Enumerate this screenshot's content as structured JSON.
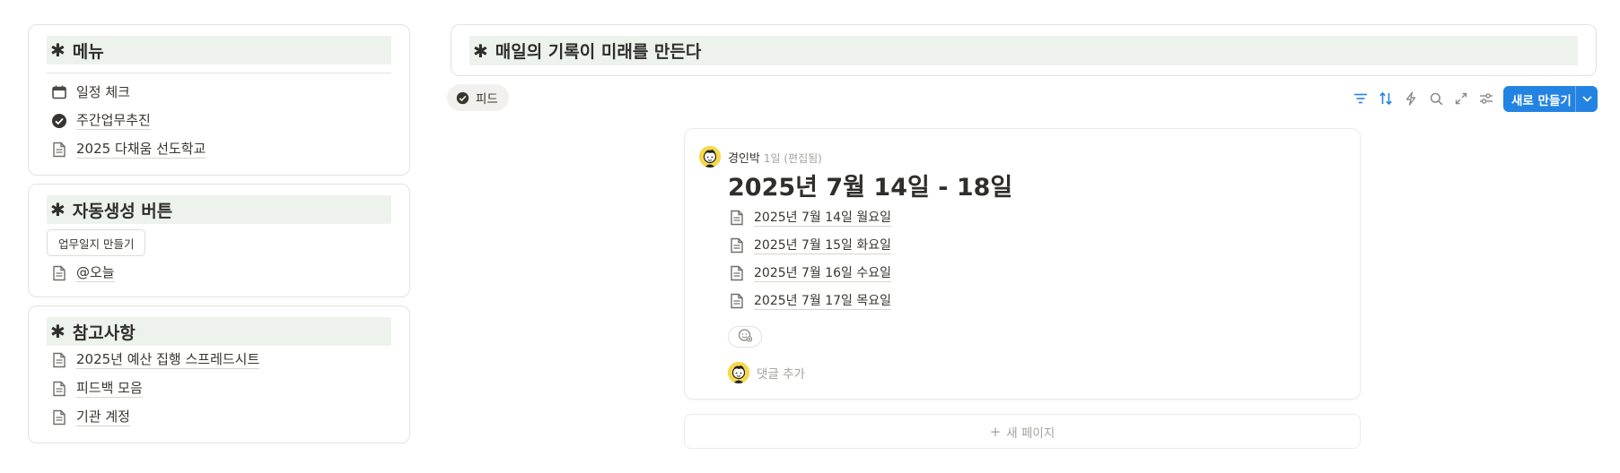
{
  "sidebar": {
    "menu": {
      "title": "메뉴",
      "items": [
        {
          "label": "일정 체크",
          "icon": "calendar-icon"
        },
        {
          "label": "주간업무추진",
          "icon": "check-circle-icon"
        },
        {
          "label": "2025 다채움 선도학교",
          "icon": "document-icon"
        }
      ]
    },
    "auto_buttons": {
      "title": "자동생성 버튼",
      "button_label": "업무일지 만들기",
      "items": [
        {
          "label": "@오늘",
          "icon": "document-icon"
        }
      ]
    },
    "references": {
      "title": "참고사항",
      "items": [
        {
          "label": "2025년 예산 집행 스프레드시트",
          "icon": "document-icon"
        },
        {
          "label": "피드백 모음",
          "icon": "document-icon"
        },
        {
          "label": "기관 계정",
          "icon": "document-icon"
        }
      ]
    }
  },
  "main": {
    "title": "매일의 기록이 미래를 만든다",
    "star": "✱",
    "view_tab": "피드",
    "toolbar": {
      "icons": [
        "filter-icon",
        "sort-icon",
        "automation-icon",
        "search-icon",
        "expand-icon",
        "settings-icon"
      ],
      "new_label": "새로 만들기"
    },
    "post": {
      "author": "경인박",
      "meta": "1일 (편집됨)",
      "title": "2025년 7월 14일 - 18일",
      "pages": [
        "2025년 7월 14일 월요일",
        "2025년 7월 15일 화요일",
        "2025년 7월 16일 수요일",
        "2025년 7월 17일 목요일"
      ],
      "comment_placeholder": "댓글 추가"
    },
    "new_page_label": "새 페이지"
  },
  "colors": {
    "accent": "#2383e2",
    "heading_bg": "#edf3ec",
    "avatar_bg": "#f6d84a"
  }
}
